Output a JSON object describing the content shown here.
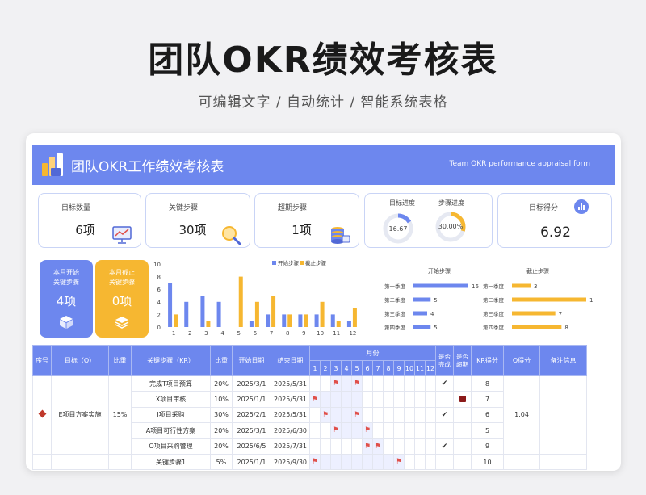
{
  "header": {
    "title": "团队OKR绩效考核表",
    "subtitle": "可编辑文字 / 自动统计 / 智能系统表格"
  },
  "banner": {
    "title": "团队OKR工作绩效考核表",
    "subtitle_en": "Team OKR performance appraisal form"
  },
  "stats": {
    "goal_count": {
      "label": "目标数量",
      "value": "6项"
    },
    "key_steps": {
      "label": "关键步骤",
      "value": "30项"
    },
    "overdue": {
      "label": "超期步骤",
      "value": "1项"
    },
    "goal_progress": {
      "label": "目标进度",
      "value": "16.67",
      "fraction": 0.1667
    },
    "step_progress": {
      "label": "步骤进度",
      "value": "30.00%",
      "fraction": 0.3
    },
    "goal_score": {
      "label": "目标得分",
      "value": "6.92"
    }
  },
  "tiles": {
    "month_start": {
      "line1": "本月开始",
      "line2": "关键步骤",
      "value": "4项",
      "color": "#6d87ee"
    },
    "month_end": {
      "line1": "本月截止",
      "line2": "关键步骤",
      "value": "0项",
      "color": "#f6b731"
    }
  },
  "chart_data": [
    {
      "type": "bar",
      "categories": [
        "1",
        "2",
        "3",
        "4",
        "5",
        "6",
        "7",
        "8",
        "9",
        "10",
        "11",
        "12"
      ],
      "series": [
        {
          "name": "开始步骤",
          "color": "#6d87ee",
          "values": [
            7,
            4,
            5,
            4,
            0,
            1,
            2,
            2,
            2,
            2,
            2,
            1
          ]
        },
        {
          "name": "截止步骤",
          "color": "#f6b731",
          "values": [
            2,
            0,
            1,
            0,
            8,
            4,
            5,
            2,
            2,
            4,
            1,
            3
          ]
        }
      ],
      "ylim": [
        0,
        10
      ],
      "yticks": [
        "0",
        "2",
        "4",
        "6",
        "8",
        "10"
      ]
    },
    {
      "type": "bar",
      "title": "开始步骤",
      "color": "#6d87ee",
      "categories": [
        "第一季度",
        "第二季度",
        "第三季度",
        "第四季度"
      ],
      "values": [
        16,
        5,
        4,
        5
      ],
      "xlim": [
        0,
        16
      ]
    },
    {
      "type": "bar",
      "title": "截止步骤",
      "color": "#f6b731",
      "categories": [
        "第一季度",
        "第二季度",
        "第三季度",
        "第四季度"
      ],
      "values": [
        3,
        12,
        7,
        8
      ],
      "xlim": [
        0,
        12
      ]
    }
  ],
  "table": {
    "headers": {
      "seq": "序号",
      "objective": "目标（O）",
      "ratio": "比重",
      "kr": "关键步骤（KR）",
      "kr_ratio": "比重",
      "start": "开始日期",
      "end": "结束日期",
      "month": "月份",
      "done": "是否完成",
      "overdue": "是否超期",
      "kr_score": "KR得分",
      "o_score": "O得分",
      "note": "备注信息"
    },
    "months": [
      "1",
      "2",
      "3",
      "4",
      "5",
      "6",
      "7",
      "8",
      "9",
      "10",
      "11",
      "12"
    ],
    "group": {
      "seq": "",
      "objective": "E项目方案实施",
      "ratio": "15%",
      "o_score": "1.04"
    },
    "rows": [
      {
        "kr": "完成T项目预算",
        "ratio": "20%",
        "start": "2025/3/1",
        "end": "2025/5/31",
        "months": [
          3,
          4,
          5
        ],
        "flags": [
          3,
          5
        ],
        "done": "✔",
        "overdue": false,
        "score": "8"
      },
      {
        "kr": "X项目审核",
        "ratio": "10%",
        "start": "2025/1/1",
        "end": "2025/5/31",
        "months": [
          1,
          2,
          3,
          4,
          5
        ],
        "flags": [
          1
        ],
        "done": "",
        "overdue": true,
        "score": "7"
      },
      {
        "kr": "I项目采购",
        "ratio": "30%",
        "start": "2025/2/1",
        "end": "2025/5/31",
        "months": [
          2,
          3,
          4,
          5
        ],
        "flags": [
          2,
          5
        ],
        "done": "✔",
        "overdue": false,
        "score": "6"
      },
      {
        "kr": "A项目可行性方案",
        "ratio": "20%",
        "start": "2025/3/1",
        "end": "2025/6/30",
        "months": [
          3,
          4,
          5,
          6
        ],
        "flags": [
          3,
          6
        ],
        "done": "",
        "overdue": false,
        "score": "5"
      },
      {
        "kr": "O项目采购管理",
        "ratio": "20%",
        "start": "2025/6/5",
        "end": "2025/7/31",
        "months": [
          6,
          7
        ],
        "flags": [
          6,
          7
        ],
        "done": "✔",
        "overdue": false,
        "score": "9"
      },
      {
        "kr": "关键步骤1",
        "ratio": "5%",
        "start": "2025/1/1",
        "end": "2025/9/30",
        "months": [
          1,
          2,
          3,
          4,
          5,
          6,
          7,
          8,
          9
        ],
        "flags": [
          1,
          9
        ],
        "done": "",
        "overdue": false,
        "score": "10"
      }
    ]
  },
  "icons": {
    "logo": "bar-chart-logo",
    "stat1": "monitor-chart-icon",
    "stat2": "magnifier-icon",
    "stat3": "database-icon",
    "stat4": "bar-chart-icon",
    "tile1": "cube-icon",
    "tile2": "layers-icon",
    "flag": "flag-icon",
    "overdue": "overdue-marker-icon"
  }
}
